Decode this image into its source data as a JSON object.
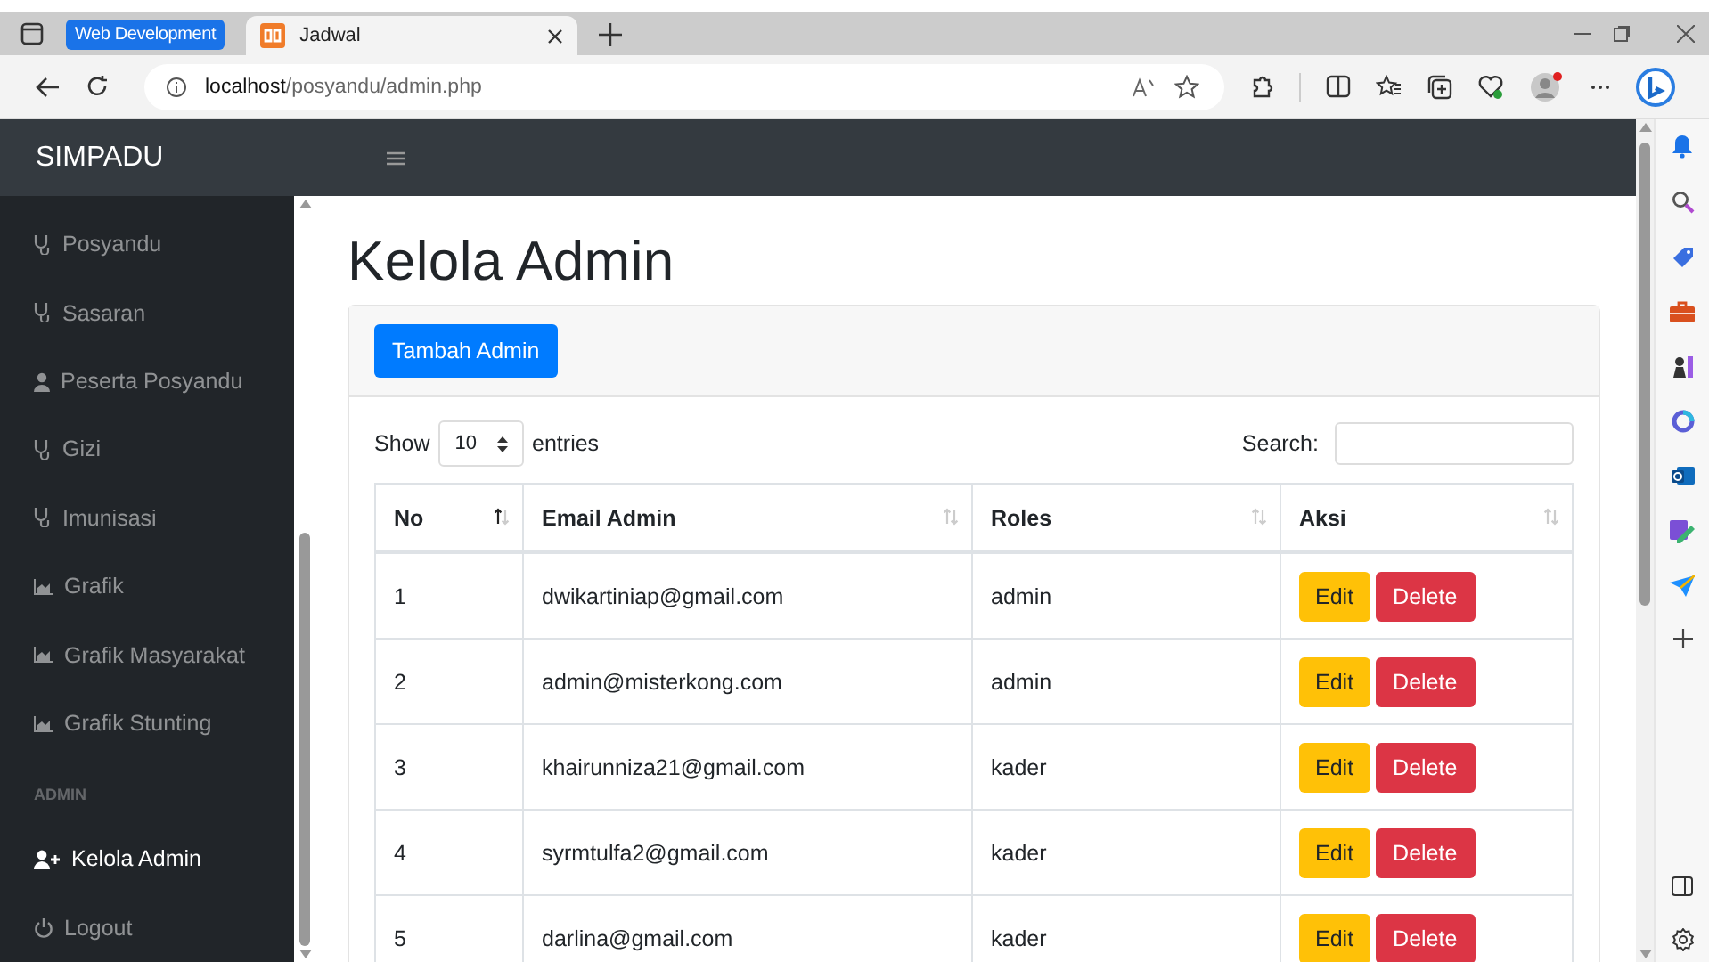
{
  "browser": {
    "tab_group": "Web Development",
    "tab": {
      "title": "Jadwal"
    },
    "url": {
      "host": "localhost",
      "path": "/posyandu/admin.php"
    }
  },
  "brand": "SIMPADU",
  "sidebar": {
    "items": [
      {
        "label": "Posyandu",
        "selected": false
      },
      {
        "label": "Sasaran",
        "selected": false
      },
      {
        "label": "Peserta Posyandu",
        "selected": false
      },
      {
        "label": "Gizi",
        "selected": false
      },
      {
        "label": "Imunisasi",
        "selected": false
      },
      {
        "label": "Grafik",
        "selected": false
      },
      {
        "label": "Grafik Masyarakat",
        "selected": false
      },
      {
        "label": "Grafik Stunting",
        "selected": false
      }
    ],
    "section_heading": "ADMIN",
    "admin_items": [
      {
        "label": "Kelola Admin",
        "selected": true
      },
      {
        "label": "Logout",
        "selected": false
      }
    ]
  },
  "page_title": "Kelola Admin",
  "add_button": "Tambah Admin",
  "length": {
    "before": "Show",
    "value": "10",
    "after": "entries"
  },
  "search": {
    "label": "Search:"
  },
  "table": {
    "columns": [
      {
        "label": "No",
        "sorted": true
      },
      {
        "label": "Email Admin",
        "sorted": false
      },
      {
        "label": "Roles",
        "sorted": false
      },
      {
        "label": "Aksi",
        "sorted": false
      }
    ],
    "rows": [
      {
        "no": "1",
        "email": "dwikartiniap@gmail.com",
        "role": "admin",
        "edit": "Edit",
        "delete": "Delete"
      },
      {
        "no": "2",
        "email": "admin@misterkong.com",
        "role": "admin",
        "edit": "Edit",
        "delete": "Delete"
      },
      {
        "no": "3",
        "email": "khairunniza21@gmail.com",
        "role": "kader",
        "edit": "Edit",
        "delete": "Delete"
      },
      {
        "no": "4",
        "email": "syrmtulfa2@gmail.com",
        "role": "kader",
        "edit": "Edit",
        "delete": "Delete"
      },
      {
        "no": "5",
        "email": "darlina@gmail.com",
        "role": "kader",
        "edit": "Edit",
        "delete": "Delete"
      }
    ]
  }
}
